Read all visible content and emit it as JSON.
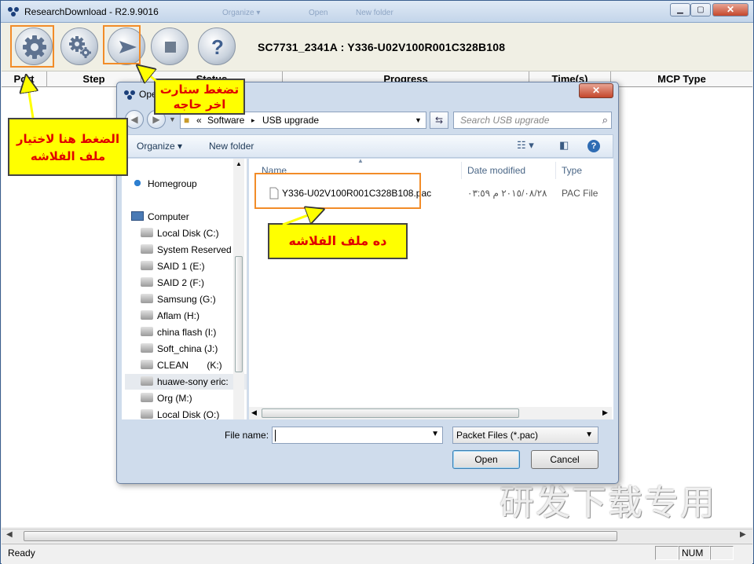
{
  "window": {
    "title": "ResearchDownload - R2.9.9016",
    "ghost_items": [
      "Organize ▾",
      "Open",
      "New folder"
    ]
  },
  "toolbar": {
    "buttons": [
      {
        "name": "load-packet-button",
        "icon": "gear-icon"
      },
      {
        "name": "settings-button",
        "icon": "gears-icon"
      },
      {
        "name": "start-button",
        "icon": "play-arrow-icon"
      },
      {
        "name": "stop-button",
        "icon": "stop-icon"
      },
      {
        "name": "help-button",
        "icon": "question-icon",
        "glyph": "?"
      }
    ],
    "model": "SC7731_2341A : Y336-U02V100R001C328B108"
  },
  "table": {
    "columns": [
      "Port",
      "Step",
      "Status",
      "Progress",
      "Time(s)",
      "MCP Type"
    ]
  },
  "status": {
    "ready": "Ready",
    "num": "NUM"
  },
  "watermark": "研发下载专用",
  "dialog": {
    "title": "Open",
    "address": {
      "chev": "«",
      "part1": "Software",
      "sep": "▸",
      "part2": "USB upgrade"
    },
    "search_placeholder": "Search USB upgrade",
    "organize": "Organize ▾",
    "new_folder": "New folder",
    "nav": [
      {
        "label": "Homegroup",
        "icon": "homegroup-icon"
      },
      {
        "label": "Computer",
        "icon": "computer-icon"
      },
      {
        "label": "Local Disk (C:)",
        "icon": "drive-icon"
      },
      {
        "label": "System Reserved",
        "icon": "drive-icon"
      },
      {
        "label": "SAID 1 (E:)",
        "icon": "drive-icon"
      },
      {
        "label": "SAID 2 (F:)",
        "icon": "drive-icon"
      },
      {
        "label": "Samsung (G:)",
        "icon": "drive-icon"
      },
      {
        "label": "Aflam (H:)",
        "icon": "drive-icon"
      },
      {
        "label": "china flash (I:)",
        "icon": "drive-icon"
      },
      {
        "label": "Soft_china (J:)",
        "icon": "drive-icon"
      },
      {
        "label": "CLEAN       (K:)",
        "icon": "drive-icon"
      },
      {
        "label": "huawe-sony eric:",
        "icon": "drive-icon"
      },
      {
        "label": "Org (M:)",
        "icon": "drive-icon"
      },
      {
        "label": "Local Disk (O:)",
        "icon": "drive-icon"
      }
    ],
    "columns": {
      "name": "Name",
      "date": "Date modified",
      "type": "Type"
    },
    "file": {
      "name": "Y336-U02V100R001C328B108.pac",
      "date": "٢٠١٥/٠٨/٢٨ م ٠٣:٥٩",
      "type": "PAC File"
    },
    "filename_label": "File name:",
    "filename_value": "",
    "filter": "Packet Files (*.pac)",
    "open": "Open",
    "cancel": "Cancel"
  },
  "callouts": {
    "choose": "الضغط هنا لاختيار ملف الفلاشه",
    "start": "تضغط ستارت اخر حاجه",
    "file": "ده ملف الفلاشه"
  }
}
